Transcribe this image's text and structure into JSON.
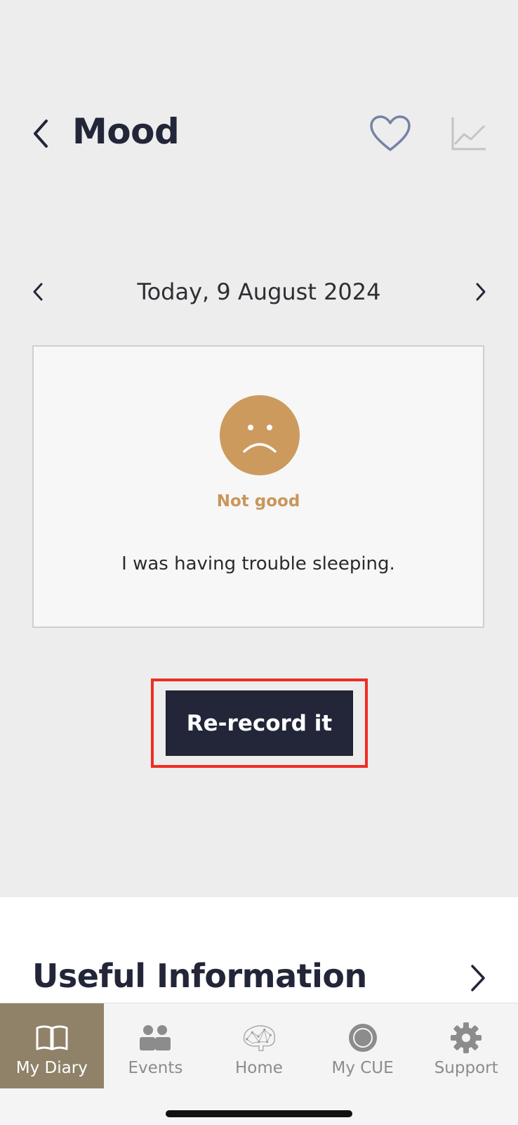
{
  "header": {
    "title": "Mood",
    "back_icon": "chevron-left-icon",
    "favorite_icon": "heart-icon",
    "chart_icon": "line-chart-icon"
  },
  "date_nav": {
    "label": "Today, 9 August 2024",
    "prev_icon": "chevron-left-icon",
    "next_icon": "chevron-right-icon"
  },
  "mood_entry": {
    "face_icon": "sad-face-icon",
    "mood_label": "Not good",
    "note": "I was having trouble sleeping.",
    "mood_color": "#cd9a5e",
    "label_color": "#c9965a"
  },
  "actions": {
    "rerecord_label": "Re-record it",
    "highlight_color": "#ee2d23"
  },
  "useful_info": {
    "title": "Useful Information",
    "chevron_icon": "chevron-right-icon"
  },
  "tabbar": {
    "active_color": "#8f8269",
    "tabs": [
      {
        "label": "My Diary",
        "icon": "open-book-icon",
        "active": true
      },
      {
        "label": "Events",
        "icon": "people-icon",
        "active": false
      },
      {
        "label": "Home",
        "icon": "brain-icon",
        "active": false
      },
      {
        "label": "My CUE",
        "icon": "ring-icon",
        "active": false
      },
      {
        "label": "Support",
        "icon": "gear-icon",
        "active": false
      }
    ]
  },
  "colors": {
    "primary_dark": "#222638",
    "background": "#ededed",
    "card_background": "#f7f7f7"
  }
}
